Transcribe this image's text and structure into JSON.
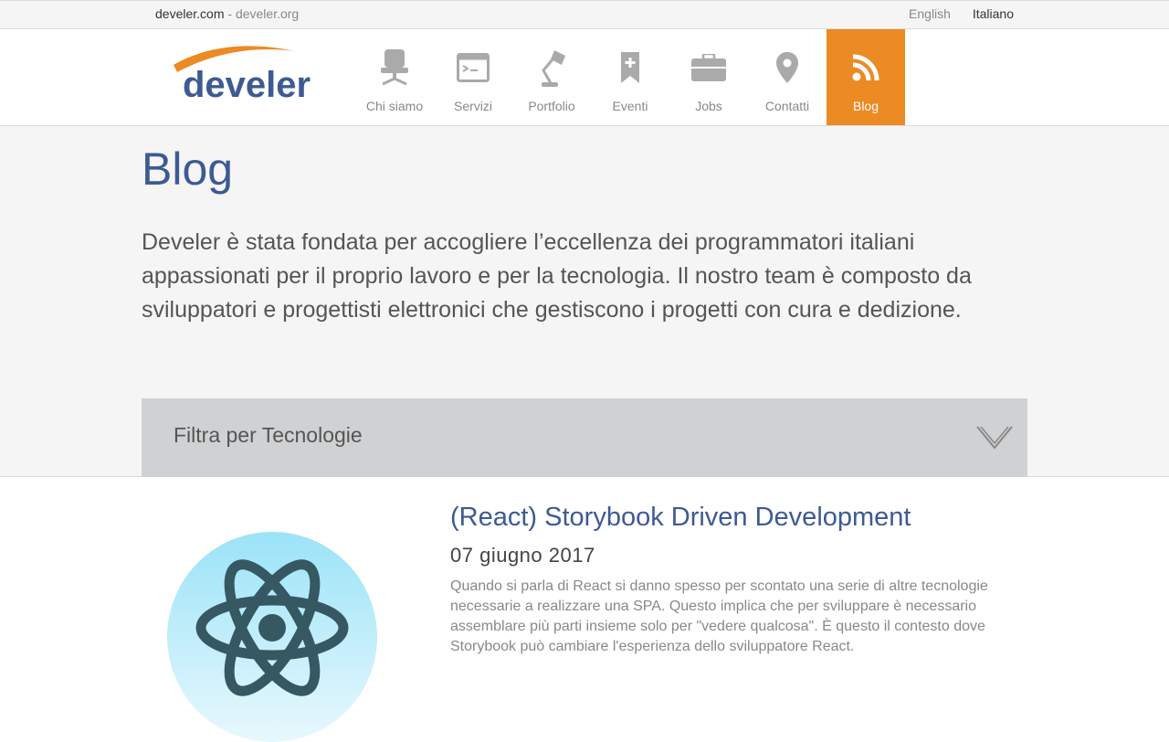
{
  "topbar": {
    "site_current": "develer.com",
    "separator": " - ",
    "site_other": "develer.org",
    "lang_english": "English",
    "lang_italiano": "Italiano"
  },
  "logo": {
    "text": "develer",
    "brand_blue": "#3d5a93",
    "brand_orange": "#ec8a23"
  },
  "nav": {
    "items": [
      {
        "label": "Chi siamo",
        "icon": "chair-icon"
      },
      {
        "label": "Servizi",
        "icon": "terminal-icon"
      },
      {
        "label": "Portfolio",
        "icon": "lamp-icon"
      },
      {
        "label": "Eventi",
        "icon": "bookmark-icon"
      },
      {
        "label": "Jobs",
        "icon": "briefcase-icon"
      },
      {
        "label": "Contatti",
        "icon": "location-pin-icon"
      },
      {
        "label": "Blog",
        "icon": "rss-icon",
        "active": true
      }
    ]
  },
  "hero": {
    "title": "Blog",
    "intro": "Develer è stata fondata per accogliere l’eccellenza dei programmatori italiani appassionati per il proprio lavoro e per la tecnologia. Il nostro team è composto da sviluppatori e progettisti elettronici che gestiscono i progetti con cura e dedizione."
  },
  "filter": {
    "label": "Filtra per Tecnologie",
    "icon": "chevron-down-icon"
  },
  "post": {
    "title": "(React) Storybook Driven Development",
    "date": "07 giugno 2017",
    "excerpt": "Quando si parla di React si danno spesso per scontato una serie di altre tecnologie necessarie a realizzare una SPA. Questo implica che per sviluppare è necessario assemblare più parti insieme solo per \"vedere qualcosa\". È questo il contesto dove Storybook può cambiare l'esperienza dello sviluppatore React.",
    "image_icon": "react-logo-icon"
  },
  "colors": {
    "accent": "#ec8a23",
    "title_blue": "#3d5a93",
    "filter_bg": "#d0d1d3",
    "hero_bg": "#f5f5f5"
  }
}
